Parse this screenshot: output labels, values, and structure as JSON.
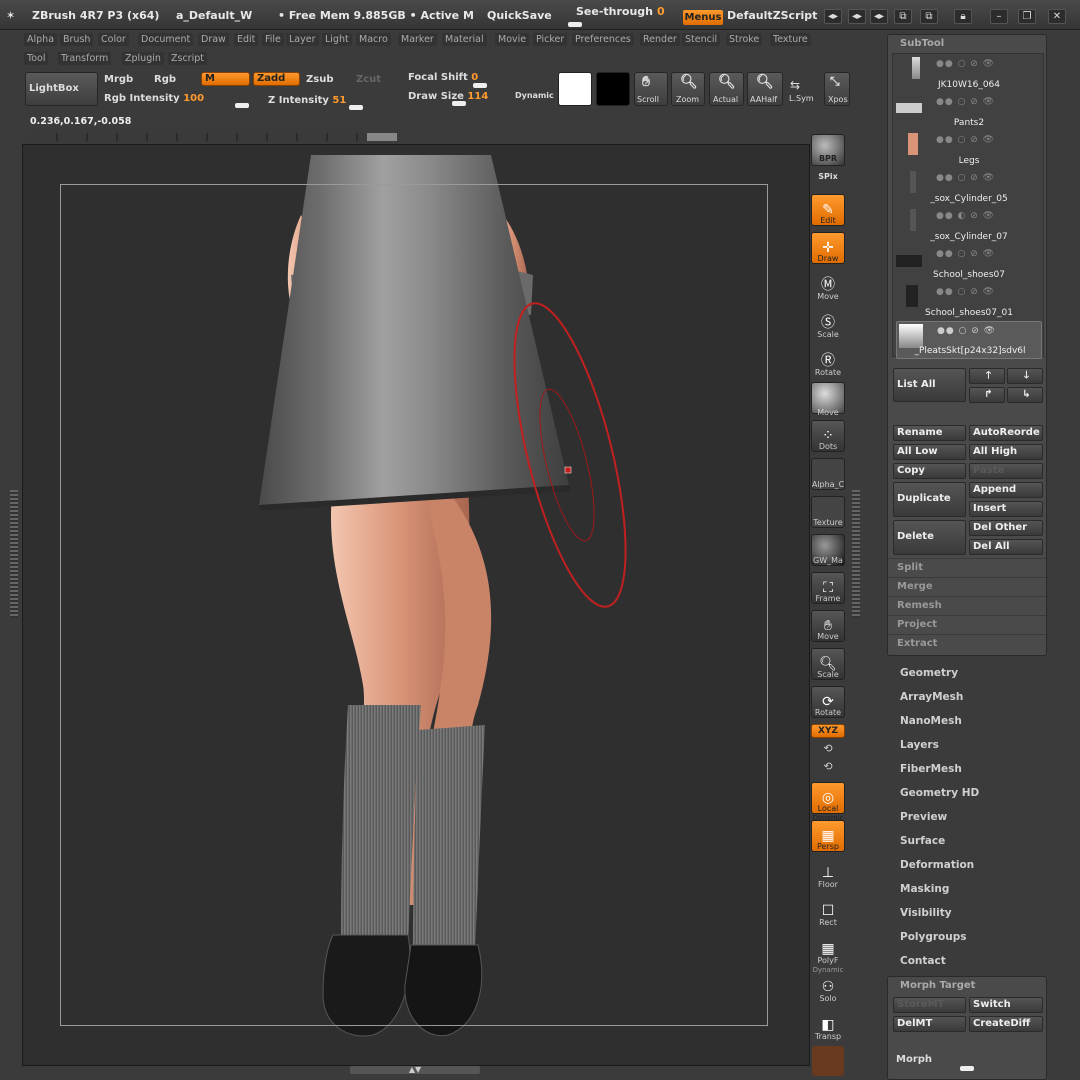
{
  "titlebar": {
    "app": "ZBrush 4R7 P3 (x64)",
    "doc": "a_Default_W",
    "mem": "• Free Mem 9.885GB • Active M",
    "quicksave": "QuickSave",
    "seethrough": "See-through",
    "seethrough_val": "0",
    "menus": "Menus",
    "script": "DefaultZScript"
  },
  "menus": [
    "Alpha",
    "Brush",
    "Color",
    "Document",
    "Draw",
    "Edit",
    "File",
    "Layer",
    "Light",
    "Macro",
    "Marker",
    "Material",
    "Movie",
    "Picker",
    "Preferences",
    "Render",
    "Stencil",
    "Stroke",
    "Texture",
    "Tool",
    "Transform",
    "Zplugin",
    "Zscript"
  ],
  "shelf": {
    "lightbox": "LightBox",
    "mrgb": "Mrgb",
    "rgb": "Rgb",
    "m": "M",
    "zadd": "Zadd",
    "zsub": "Zsub",
    "zcut": "Zcut",
    "rgb_intensity": "Rgb Intensity",
    "rgb_intensity_val": "100",
    "z_intensity": "Z Intensity",
    "z_intensity_val": "51",
    "focal_shift": "Focal Shift",
    "focal_shift_val": "0",
    "draw_size": "Draw Size",
    "draw_size_val": "114",
    "dynamic": "Dynamic",
    "scroll": "Scroll",
    "zoom": "Zoom",
    "actual": "Actual",
    "aahalf": "AAHalf",
    "lsym": "L.Sym",
    "xpose": "Xpos",
    "coords": "0.236,0.167,-0.058"
  },
  "righttools": {
    "bpr": "BPR",
    "spix": "SPix",
    "edit": "Edit",
    "draw": "Draw",
    "move": "Move",
    "scale": "Scale",
    "rotate": "Rotate",
    "move2": "Move",
    "dots": "Dots",
    "alpha": "Alpha_C",
    "texture": "Texture",
    "material": "GW_Ma",
    "frame": "Frame",
    "move3": "Move",
    "scale2": "Scale",
    "rotate2": "Rotate",
    "xyz": "XYZ",
    "local": "Local",
    "persp": "Persp",
    "floor": "Floor",
    "rect": "Rect",
    "polyf": "PolyF",
    "solo": "Solo",
    "transp": "Transp",
    "dynamic": "Dynamic"
  },
  "subtool": {
    "title": "SubTool",
    "items": [
      {
        "name": "JK10W16_064"
      },
      {
        "name": "Pants2"
      },
      {
        "name": "Legs"
      },
      {
        "name": "_sox_Cylinder_05"
      },
      {
        "name": "_sox_Cylinder_07"
      },
      {
        "name": "School_shoes07"
      },
      {
        "name": "School_shoes07_01"
      },
      {
        "name": "_PleatsSkt[p24x32]sdv6l"
      }
    ],
    "list_all": "List All",
    "rename": "Rename",
    "autoreorder": "AutoReorde",
    "all_low": "All Low",
    "all_high": "All High",
    "copy": "Copy",
    "paste": "Paste",
    "duplicate": "Duplicate",
    "append": "Append",
    "insert": "Insert",
    "delete": "Delete",
    "del_other": "Del Other",
    "del_all": "Del All",
    "sections": [
      "Split",
      "Merge",
      "Remesh",
      "Project",
      "Extract"
    ]
  },
  "tool_menu": [
    "Geometry",
    "ArrayMesh",
    "NanoMesh",
    "Layers",
    "FiberMesh",
    "Geometry HD",
    "Preview",
    "Surface",
    "Deformation",
    "Masking",
    "Visibility",
    "Polygroups",
    "Contact"
  ],
  "morph": {
    "title": "Morph Target",
    "storemt": "StoreMT",
    "switch": "Switch",
    "delmt": "DelMT",
    "creatediff": "CreateDiff",
    "morph": "Morph"
  },
  "colors": {
    "accent": "#ff8a1a",
    "panel": "#4a4a4a",
    "bg": "#3b3b3b",
    "viewport": "#2f2f2f"
  }
}
